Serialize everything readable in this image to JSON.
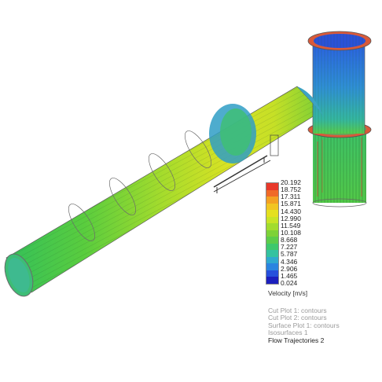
{
  "legend": {
    "title": "Velocity [m/s]",
    "ticks": [
      "20.192",
      "18.752",
      "17.311",
      "15.871",
      "14.430",
      "12.990",
      "11.549",
      "10.108",
      "8.668",
      "7.227",
      "5.787",
      "4.346",
      "2.906",
      "1.465",
      "0.024"
    ],
    "colors": [
      "#e8382a",
      "#f06a28",
      "#f4a122",
      "#f2c521",
      "#e4e020",
      "#c8e426",
      "#a2dc2e",
      "#7dd238",
      "#5ccc4a",
      "#3ec86c",
      "#34c2a0",
      "#2fa9cf",
      "#2a84e0",
      "#2650dc",
      "#1c1fbe"
    ]
  },
  "features": [
    {
      "label": "Cut Plot 1: contours",
      "active": false
    },
    {
      "label": "Cut Plot 2: contours",
      "active": false
    },
    {
      "label": "Surface Plot 1: contours",
      "active": false
    },
    {
      "label": "Isosurfaces 1",
      "active": false
    },
    {
      "label": "Flow Trajectories 2",
      "active": true
    }
  ]
}
